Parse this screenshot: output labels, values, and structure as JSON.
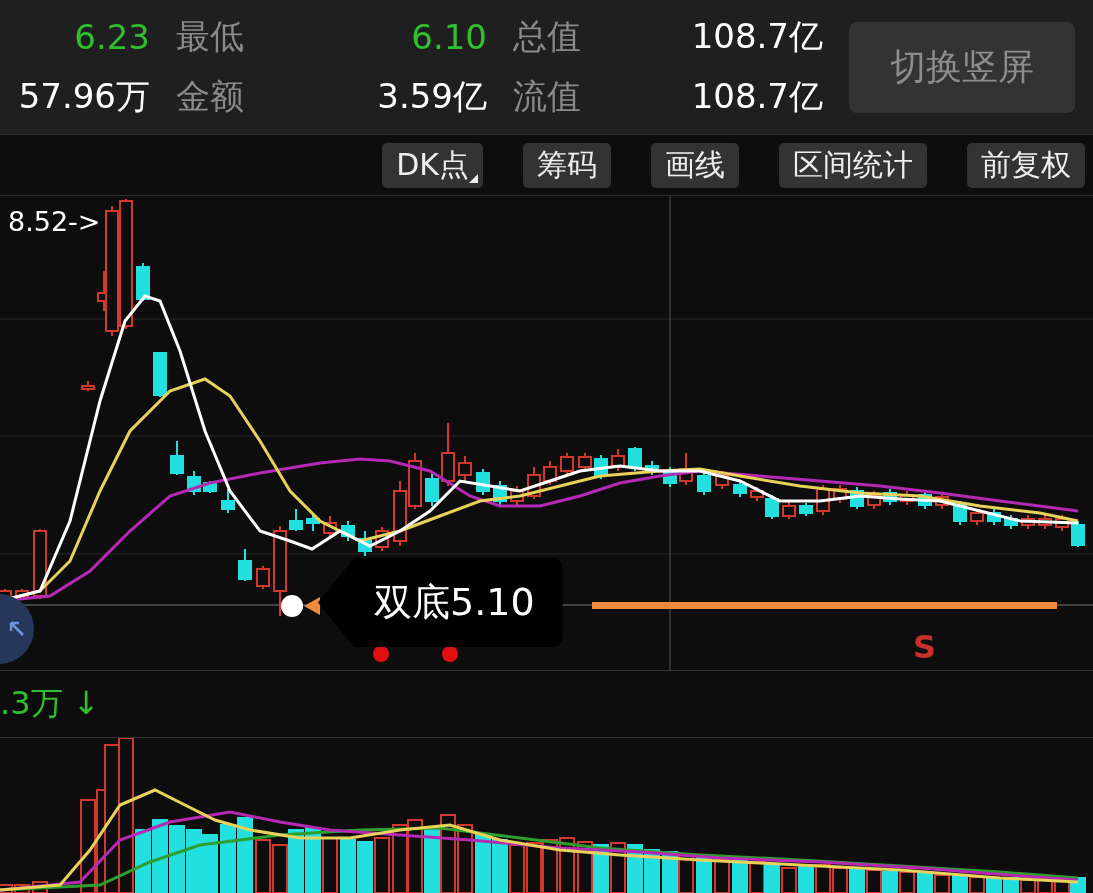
{
  "stats": {
    "rows": [
      {
        "cells": [
          {
            "kind": "value",
            "text": "6.23",
            "color": "#2fbf2f"
          },
          {
            "kind": "label",
            "text": "最低"
          },
          {
            "kind": "value",
            "text": "6.10",
            "color": "#2fbf2f"
          },
          {
            "kind": "label",
            "text": "总值"
          },
          {
            "kind": "value",
            "text": "108.7亿",
            "color": "#ffffff"
          }
        ]
      },
      {
        "cells": [
          {
            "kind": "value",
            "text": "57.96万",
            "color": "#ffffff"
          },
          {
            "kind": "label",
            "text": "金额"
          },
          {
            "kind": "value",
            "text": "3.59亿",
            "color": "#ffffff"
          },
          {
            "kind": "label",
            "text": "流值"
          },
          {
            "kind": "value",
            "text": "108.7亿",
            "color": "#ffffff"
          }
        ]
      }
    ],
    "button": "切换竖屏"
  },
  "toolbar": [
    {
      "label": "DK点",
      "dropdown": true
    },
    {
      "label": "筹码",
      "dropdown": false
    },
    {
      "label": "画线",
      "dropdown": false
    },
    {
      "label": "区间统计",
      "dropdown": false
    },
    {
      "label": "前复权",
      "dropdown": false
    }
  ],
  "chart": {
    "high_label": "8.52->",
    "tag": "双底5.10",
    "signal": "S"
  },
  "volume": {
    "label": ".3万 ↓"
  }
}
